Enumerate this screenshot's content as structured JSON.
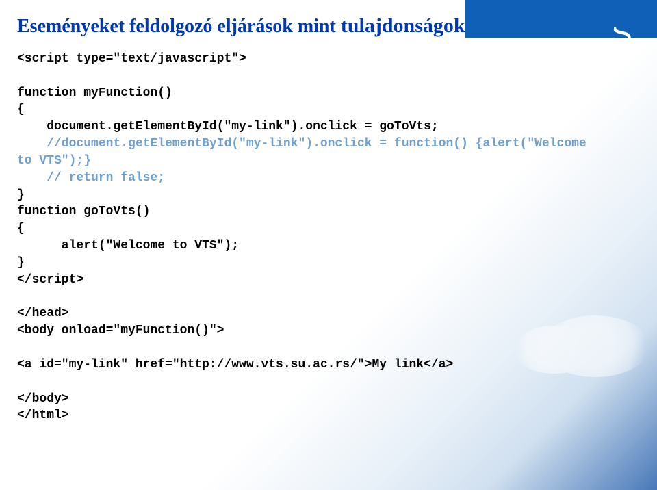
{
  "title": {
    "part1": "Eseményeket feldolgozó eljárások mint ",
    "part2": "tulajdonságok"
  },
  "code": {
    "line01": "<script type=\"text/javascript\">",
    "line02": "",
    "line03": "function myFunction()",
    "line04": "{",
    "line05": "    document.getElementById(\"my-link\").onclick = goToVts;",
    "line06_comment": "    //document.getElementById(\"my-link\").onclick = function() {alert(\"Welcome",
    "line07_comment": "to VTS\");}",
    "line08_comment": "    // return false;",
    "line09": "}",
    "line10": "function goToVts()",
    "line11": "{",
    "line12": "      alert(\"Welcome to VTS\");",
    "line13": "}",
    "line14": "</script>",
    "line15": "",
    "line16": "</head>",
    "line17": "<body onload=\"myFunction()\">",
    "line18": "",
    "line19": "<a id=\"my-link\" href=\"http://www.vts.su.ac.rs/\">My link</a>",
    "line20": "",
    "line21": "</body>",
    "line22": "</html>"
  },
  "side_letter": "S"
}
